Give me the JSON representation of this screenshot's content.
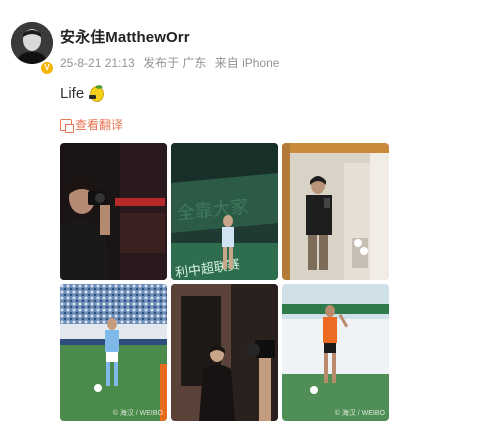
{
  "post": {
    "username": "安永佳MatthewOrr",
    "meta": {
      "timestamp": "25-8-21 21:13",
      "location": "发布于 广东",
      "source": "来自 iPhone"
    },
    "text": "Life",
    "emoji": "lemon-emoji",
    "translate_label": "查看翻译",
    "verified_color": "#f6b300",
    "accent_color": "#eb7350"
  },
  "photos": [
    {
      "description_icon": "photo",
      "watermark": ""
    },
    {
      "description_icon": "photo",
      "watermark": ""
    },
    {
      "description_icon": "photo",
      "watermark": ""
    },
    {
      "description_icon": "photo",
      "watermark": "© 海汉 / WEIBO"
    },
    {
      "description_icon": "photo",
      "watermark": ""
    },
    {
      "description_icon": "photo",
      "watermark": "© 海汉 / WEIBO"
    }
  ],
  "stadium_banner_text": "全靠大家 一起 加油",
  "banner_text_2": "中超联赛"
}
